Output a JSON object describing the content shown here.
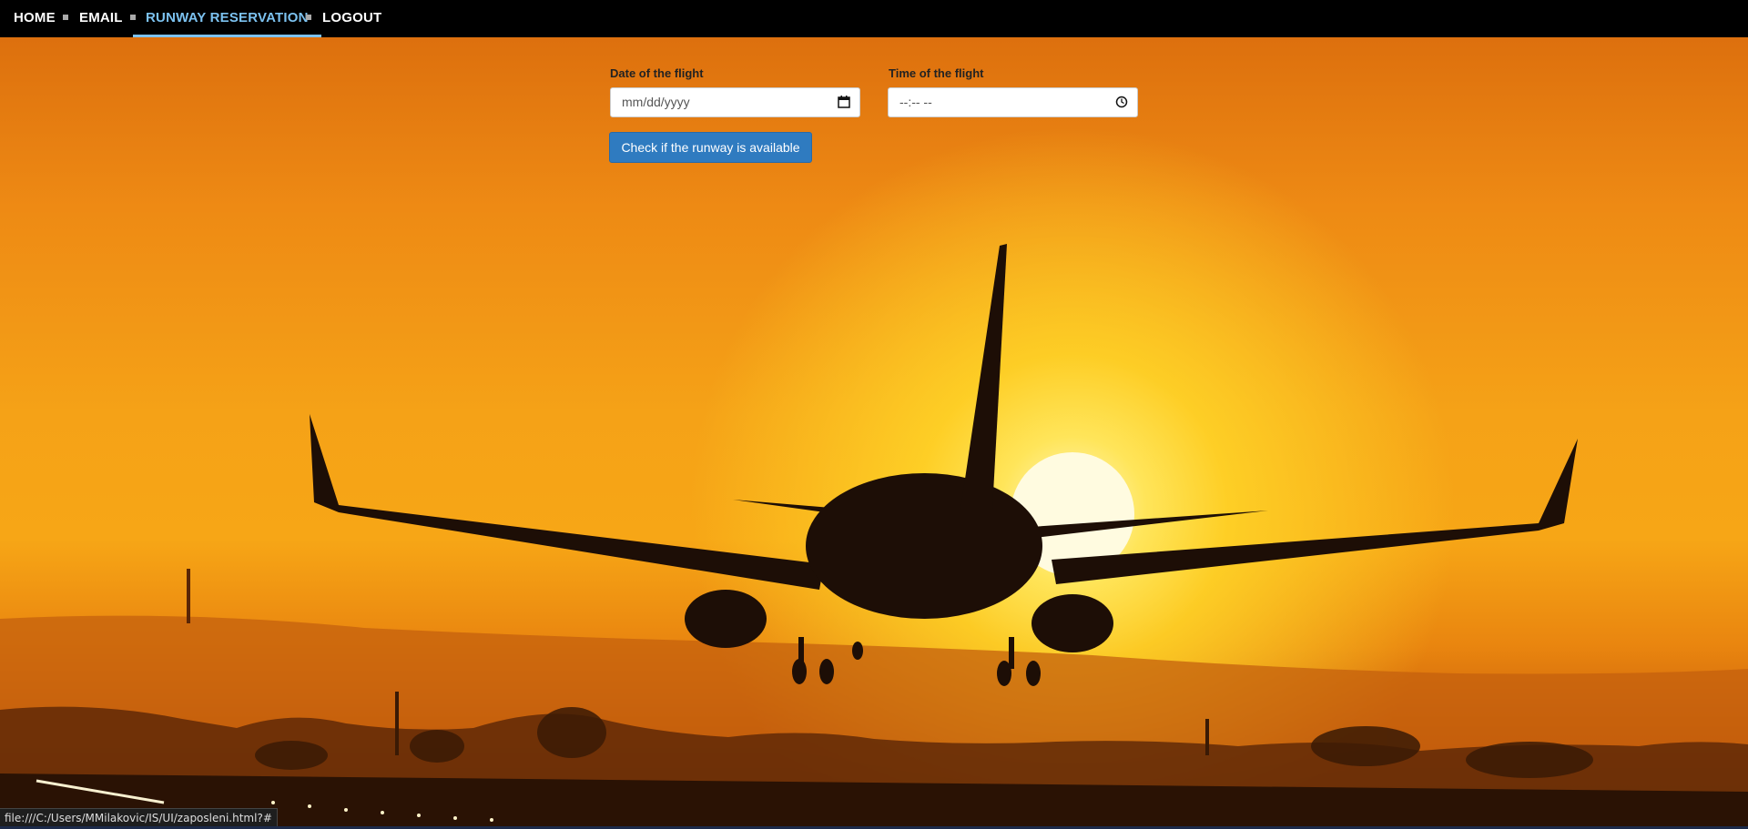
{
  "nav": {
    "items": [
      {
        "label": "HOME"
      },
      {
        "label": "EMAIL"
      },
      {
        "label": "RUNWAY RESERVATION",
        "active": true
      },
      {
        "label": "LOGOUT"
      }
    ]
  },
  "form": {
    "date_label": "Date of the flight",
    "date_placeholder": "mm/dd/yyyy",
    "time_label": "Time of the flight",
    "time_placeholder": "--:-- --",
    "check_button": "Check if the runway is available"
  },
  "status_bar": {
    "url": "file:///C:/Users/MMilakovic/IS/UI/zaposleni.html?#"
  },
  "colors": {
    "nav_bg": "#000000",
    "nav_active": "#7cc2f0",
    "button_bg": "#2f7bc0"
  },
  "icons": {
    "date_field": "calendar-icon",
    "time_field": "clock-icon"
  }
}
